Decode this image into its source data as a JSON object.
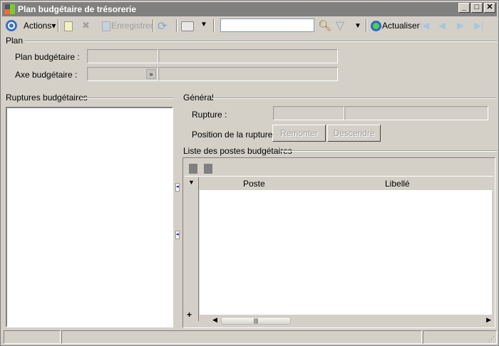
{
  "window": {
    "title": "Plan budgétaire de trésorerie"
  },
  "toolbar": {
    "actions": "Actions",
    "save": "Enregistrer",
    "refresh": "Actualiser",
    "search_value": ""
  },
  "plan": {
    "section": "Plan",
    "plan_label": "Plan budgétaire :",
    "axe_label": "Axe budgétaire :"
  },
  "ruptures": {
    "section": "Ruptures budgétaires"
  },
  "general": {
    "section": "Général",
    "rupture_label": "Rupture :",
    "position_label": "Position de la rupture :",
    "up": "Remonter",
    "down": "Descendre"
  },
  "postes": {
    "section": "Liste des postes budgétaires",
    "columns": [
      "Poste",
      "Libellé"
    ],
    "add": "+"
  }
}
